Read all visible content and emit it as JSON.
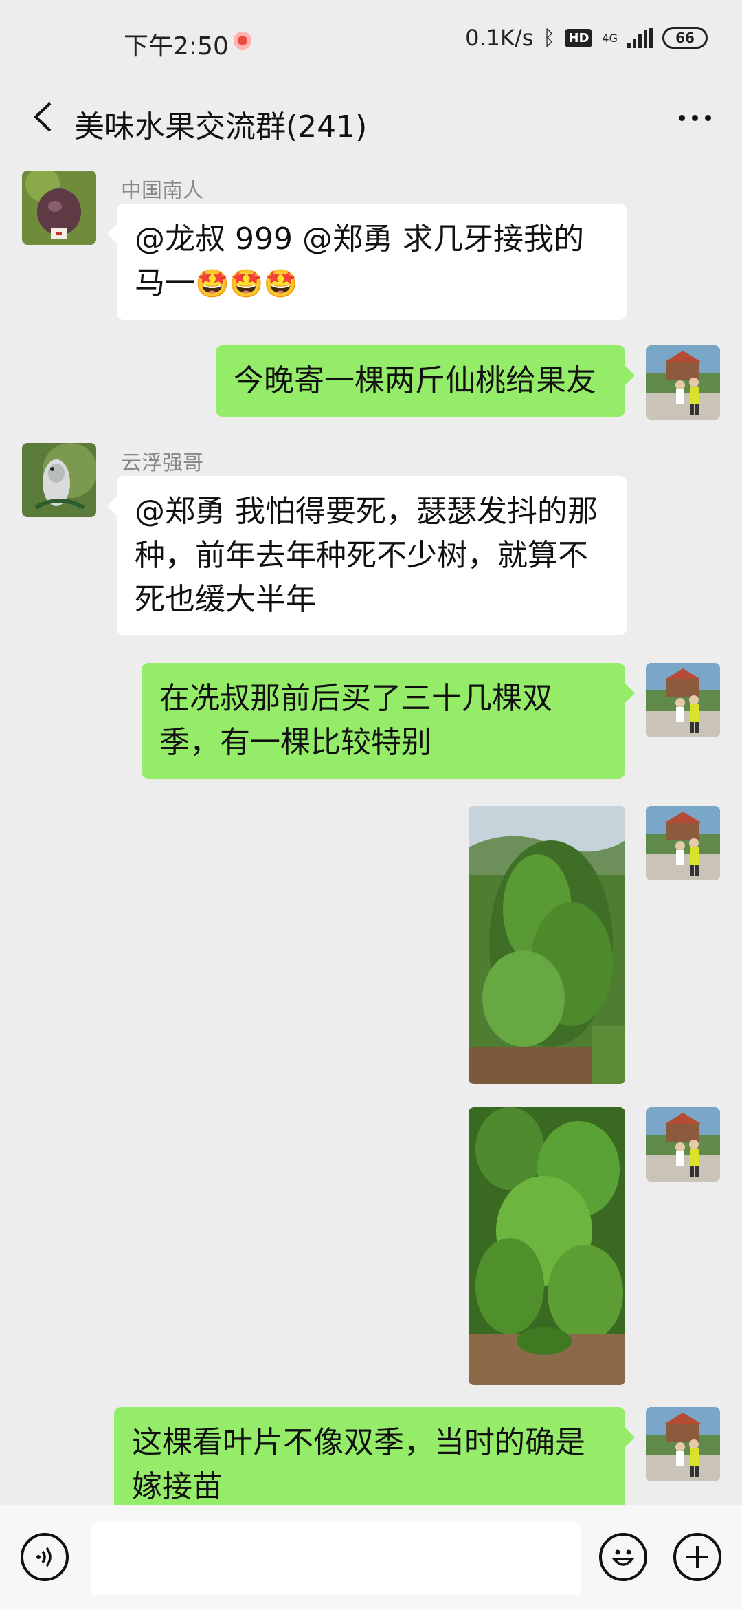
{
  "status_bar": {
    "time": "下午2:50",
    "network_speed": "0.1K/s",
    "hd": "HD",
    "network_type": "4G",
    "battery": "66"
  },
  "header": {
    "title": "美味水果交流群(241)",
    "back_icon": "chevron-left-icon",
    "more_icon": "more-dots-icon"
  },
  "messages": [
    {
      "side": "left",
      "sender": "中国南人",
      "text": "@龙叔 999 @郑勇  求几牙接我的马一",
      "emojis": "🤩🤩🤩"
    },
    {
      "side": "right",
      "text": "今晚寄一棵两斤仙桃给果友"
    },
    {
      "side": "left",
      "sender": "云浮强哥",
      "text": "@郑勇 我怕得要死，瑟瑟发抖的那种，前年去年种死不少树，就算不死也缓大半年"
    },
    {
      "side": "right",
      "text": "在冼叔那前后买了三十几棵双季，有一棵比较特别"
    },
    {
      "side": "right",
      "type": "image",
      "alt": "tree photo 1"
    },
    {
      "side": "right",
      "type": "image",
      "alt": "tree photo 2"
    },
    {
      "side": "right",
      "text": "这棵看叶片不像双季，当时的确是嫁接苗"
    }
  ],
  "input_bar": {
    "voice_icon": "voice-icon",
    "emoji_icon": "emoji-icon",
    "plus_icon": "plus-icon",
    "placeholder": ""
  },
  "colors": {
    "background": "#ededed",
    "my_bubble": "#95ec69",
    "other_bubble": "#ffffff"
  }
}
